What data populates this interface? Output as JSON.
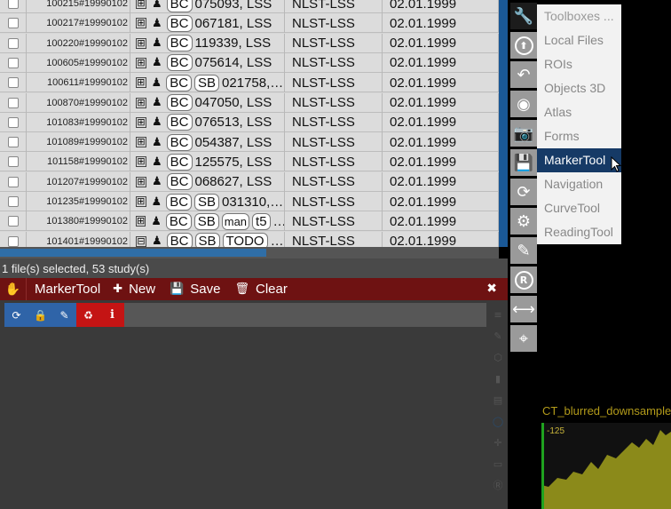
{
  "table": {
    "rows": [
      {
        "id": "100215#19990102",
        "tags": [
          "BC"
        ],
        "desc": "075093, LSS",
        "source": "NLST-LSS",
        "date": "02.01.1999",
        "expand": "⊞"
      },
      {
        "id": "100217#19990102",
        "tags": [
          "BC"
        ],
        "desc": "067181, LSS",
        "source": "NLST-LSS",
        "date": "02.01.1999",
        "expand": "⊞"
      },
      {
        "id": "100220#19990102",
        "tags": [
          "BC"
        ],
        "desc": "119339, LSS",
        "source": "NLST-LSS",
        "date": "02.01.1999",
        "expand": "⊞"
      },
      {
        "id": "100605#19990102",
        "tags": [
          "BC"
        ],
        "desc": "075614, LSS",
        "source": "NLST-LSS",
        "date": "02.01.1999",
        "expand": "⊞"
      },
      {
        "id": "100611#19990102",
        "tags": [
          "BC",
          "SB"
        ],
        "desc": "021758, …",
        "source": "NLST-LSS",
        "date": "02.01.1999",
        "expand": "⊞"
      },
      {
        "id": "100870#19990102",
        "tags": [
          "BC"
        ],
        "desc": "047050, LSS",
        "source": "NLST-LSS",
        "date": "02.01.1999",
        "expand": "⊞"
      },
      {
        "id": "101083#19990102",
        "tags": [
          "BC"
        ],
        "desc": "076513, LSS",
        "source": "NLST-LSS",
        "date": "02.01.1999",
        "expand": "⊞"
      },
      {
        "id": "101089#19990102",
        "tags": [
          "BC"
        ],
        "desc": "054387, LSS",
        "source": "NLST-LSS",
        "date": "02.01.1999",
        "expand": "⊞"
      },
      {
        "id": "101158#19990102",
        "tags": [
          "BC"
        ],
        "desc": "125575, LSS",
        "source": "NLST-LSS",
        "date": "02.01.1999",
        "expand": "⊞"
      },
      {
        "id": "101207#19990102",
        "tags": [
          "BC"
        ],
        "desc": "068627, LSS",
        "source": "NLST-LSS",
        "date": "02.01.1999",
        "expand": "⊞"
      },
      {
        "id": "101235#19990102",
        "tags": [
          "BC",
          "SB"
        ],
        "desc": "031310, …",
        "source": "NLST-LSS",
        "date": "02.01.1999",
        "expand": "⊞"
      },
      {
        "id": "101380#19990102",
        "tags": [
          "BC",
          "SB",
          "man",
          "t5"
        ],
        "desc": "…",
        "source": "NLST-LSS",
        "date": "02.01.1999",
        "expand": "⊞"
      },
      {
        "id": "101401#19990102",
        "tags": [
          "BC",
          "SB",
          "TODO"
        ],
        "desc": "…",
        "source": "NLST-LSS",
        "date": "02.01.1999",
        "expand": "⊟"
      }
    ]
  },
  "status": {
    "text": "1 file(s) selected, 53 study(s)"
  },
  "panel": {
    "title": "MarkerTool",
    "new_label": "New",
    "save_label": "Save",
    "clear_label": "Clear",
    "close_glyph": "✖",
    "hand_glyph": "✋",
    "new_glyph": "✚",
    "save_glyph": "💾",
    "clear_glyph": "🗑"
  },
  "mini_toolbar": {
    "refresh_glyph": "⟳",
    "lock_glyph": "🔒",
    "edit_glyph": "✎",
    "recycle_glyph": "♻",
    "info_glyph": "i"
  },
  "side_icons": [
    "≡",
    "✎",
    "⬡",
    "▮",
    "▤",
    "◯",
    "✛",
    "▭",
    "Ⓡ"
  ],
  "right_toolbar": {
    "wrench_glyph": "🔧",
    "up_glyph": "⬆",
    "undo_glyph": "↶",
    "globe_glyph": "◉",
    "camera_glyph": "📷",
    "save_glyph": "💾",
    "sync_glyph": "⟳",
    "gears_glyph": "⚙",
    "pencil_glyph": "✎",
    "registered_glyph": "R",
    "arrows_glyph": "⟷",
    "crosshair_glyph": "⌖"
  },
  "toolbox_menu": {
    "header": "Toolboxes ...",
    "items": [
      "Local Files",
      "ROIs",
      "Objects 3D",
      "Atlas",
      "Forms",
      "MarkerTool",
      "Navigation",
      "CurveTool",
      "ReadingTool"
    ],
    "selected": "MarkerTool"
  },
  "thumbnail": {
    "label": "CT_blurred_downsampled",
    "value": "-125"
  },
  "colors": {
    "panel_header": "#6e1212",
    "selected_menu": "#163a66",
    "accent_blue": "#2f64a8",
    "accent_red": "#c41414",
    "thumbnail_label": "#b39b1a"
  }
}
